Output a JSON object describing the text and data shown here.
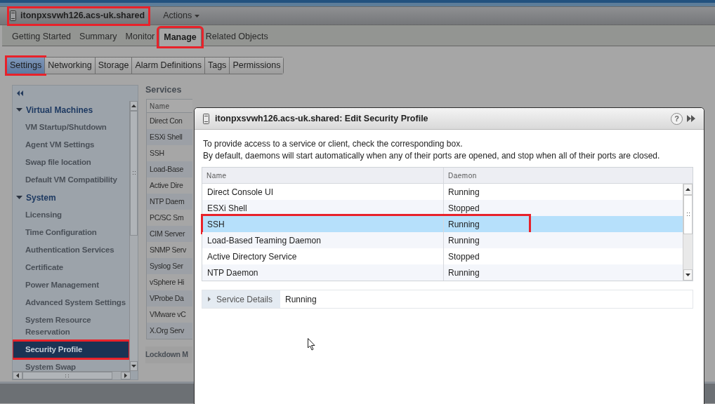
{
  "header": {
    "title": "itonpxsvwh126.acs-uk.shared",
    "highlighted": true,
    "actions": "Actions"
  },
  "tabs": [
    {
      "label": "Getting Started",
      "selected": false,
      "highlighted": false
    },
    {
      "label": "Summary",
      "selected": false,
      "highlighted": false
    },
    {
      "label": "Monitor",
      "selected": false,
      "highlighted": false
    },
    {
      "label": "Manage",
      "selected": true,
      "highlighted": true
    },
    {
      "label": "Related Objects",
      "selected": false,
      "highlighted": false
    }
  ],
  "subtabs": [
    {
      "label": "Settings",
      "selected": true,
      "highlighted": true
    },
    {
      "label": "Networking",
      "selected": false,
      "highlighted": false
    },
    {
      "label": "Storage",
      "selected": false,
      "highlighted": false
    },
    {
      "label": "Alarm Definitions",
      "selected": false,
      "highlighted": false
    },
    {
      "label": "Tags",
      "selected": false,
      "highlighted": false
    },
    {
      "label": "Permissions",
      "selected": false,
      "highlighted": false
    }
  ],
  "sidebar": {
    "items": [
      {
        "label": "Virtual Machines",
        "expanded": true,
        "children": [
          {
            "label": "VM Startup/Shutdown",
            "selected": false,
            "highlighted": false
          },
          {
            "label": "Agent VM Settings",
            "selected": false,
            "highlighted": false
          },
          {
            "label": "Swap file location",
            "selected": false,
            "highlighted": false
          },
          {
            "label": "Default VM Compatibility",
            "selected": false,
            "highlighted": false
          }
        ]
      },
      {
        "label": "System",
        "expanded": true,
        "children": [
          {
            "label": "Licensing",
            "selected": false,
            "highlighted": false
          },
          {
            "label": "Time Configuration",
            "selected": false,
            "highlighted": false
          },
          {
            "label": "Authentication Services",
            "selected": false,
            "highlighted": false
          },
          {
            "label": "Certificate",
            "selected": false,
            "highlighted": false
          },
          {
            "label": "Power Management",
            "selected": false,
            "highlighted": false
          },
          {
            "label": "Advanced System Settings",
            "selected": false,
            "highlighted": false
          },
          {
            "label": "System Resource Reservation",
            "selected": false,
            "highlighted": false
          },
          {
            "label": "Security Profile",
            "selected": true,
            "highlighted": true
          },
          {
            "label": "System Swap",
            "selected": false,
            "highlighted": false
          }
        ]
      }
    ]
  },
  "services": {
    "title": "Services",
    "columns": [
      "Name"
    ],
    "rows": [
      "Direct Con",
      "ESXi Shell",
      "SSH",
      "Load-Base",
      "Active Dire",
      "NTP Daem",
      "PC/SC Sm",
      "CIM Server",
      "SNMP Serv",
      "Syslog Ser",
      "vSphere Hi",
      "VProbe Da",
      "VMware vC",
      "X.Org Serv"
    ],
    "next_section": "Lockdown M"
  },
  "dialog": {
    "title": "itonpxsvwh126.acs-uk.shared: Edit Security Profile",
    "help": "?",
    "intro": [
      "To provide access to a service or client, check the corresponding box.",
      "By default, daemons will start automatically when any of their ports are opened, and stop when all of their ports are closed."
    ],
    "table": {
      "columns": [
        "Name",
        "Daemon"
      ],
      "rows": [
        {
          "name": "Direct Console UI",
          "daemon": "Running",
          "selected": false,
          "highlighted": false
        },
        {
          "name": "ESXi Shell",
          "daemon": "Stopped",
          "selected": false,
          "highlighted": false
        },
        {
          "name": "SSH",
          "daemon": "Running",
          "selected": true,
          "highlighted": true
        },
        {
          "name": "Load-Based Teaming Daemon",
          "daemon": "Running",
          "selected": false,
          "highlighted": false
        },
        {
          "name": "Active Directory Service",
          "daemon": "Stopped",
          "selected": false,
          "highlighted": false
        },
        {
          "name": "NTP Daemon",
          "daemon": "Running",
          "selected": false,
          "highlighted": false
        }
      ]
    },
    "details": {
      "label": "Service Details",
      "expanded": false,
      "value": "Running"
    }
  }
}
